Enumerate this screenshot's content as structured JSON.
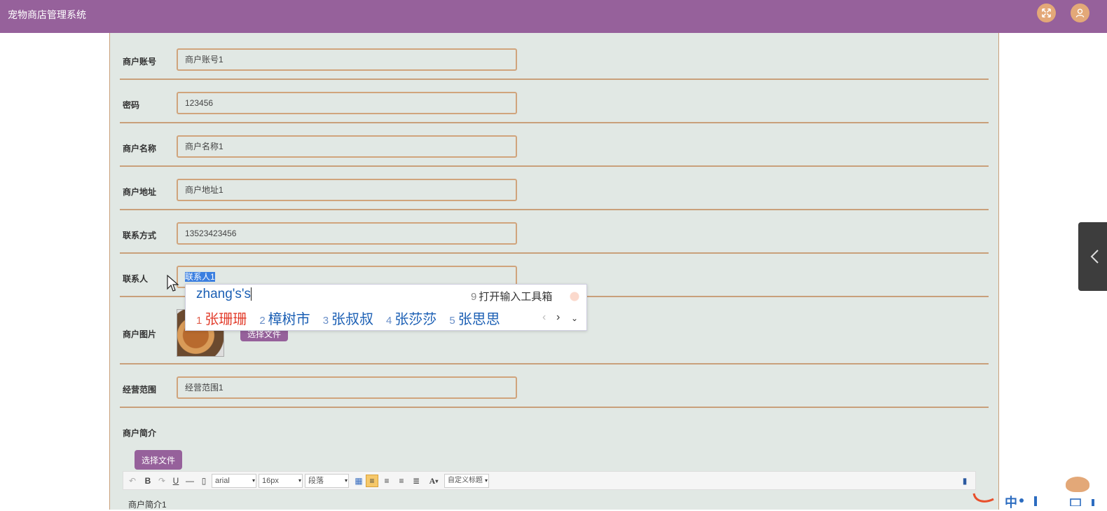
{
  "app": {
    "title": "宠物商店管理系统"
  },
  "header": {
    "fullscreen_icon": "expand-icon",
    "user_icon": "user-icon"
  },
  "form": {
    "account": {
      "label": "商户账号",
      "value": "商户账号1"
    },
    "password": {
      "label": "密码",
      "value": "123456"
    },
    "name": {
      "label": "商户名称",
      "value": "商户名称1"
    },
    "address": {
      "label": "商户地址",
      "value": "商户地址1"
    },
    "phone": {
      "label": "联系方式",
      "value": "13523423456"
    },
    "contact": {
      "label": "联系人",
      "value": "联系人1"
    },
    "image": {
      "label": "商户图片",
      "button_label": "选择文件"
    },
    "scope": {
      "label": "经营范围",
      "value": "经营范围1"
    },
    "intro": {
      "label": "商户简介",
      "button_label": "选择文件",
      "content": "商户简介1"
    }
  },
  "editor_toolbar": {
    "bold": "B",
    "underline": "U",
    "font_family": "arial",
    "font_size": "16px",
    "paragraph": "段落",
    "font_color": "A",
    "custom_title": "自定义标题"
  },
  "ime": {
    "pinyin": "zhang's's",
    "toolbox_number": "9",
    "toolbox_label": "打开输入工具箱",
    "candidates": [
      {
        "num": "1",
        "text": "张珊珊"
      },
      {
        "num": "2",
        "text": "樟树市"
      },
      {
        "num": "3",
        "text": "张叔叔"
      },
      {
        "num": "4",
        "text": "张莎莎"
      },
      {
        "num": "5",
        "text": "张思思"
      }
    ]
  },
  "tray": {
    "ime_mode": "中"
  },
  "colors": {
    "header": "#96619b",
    "panel": "#e1e8e4",
    "border": "#c9a07b",
    "accent_button": "#e3a878",
    "selection": "#3b7fe0",
    "candidate_first": "#e23d2c",
    "candidate": "#1b5fb4"
  }
}
